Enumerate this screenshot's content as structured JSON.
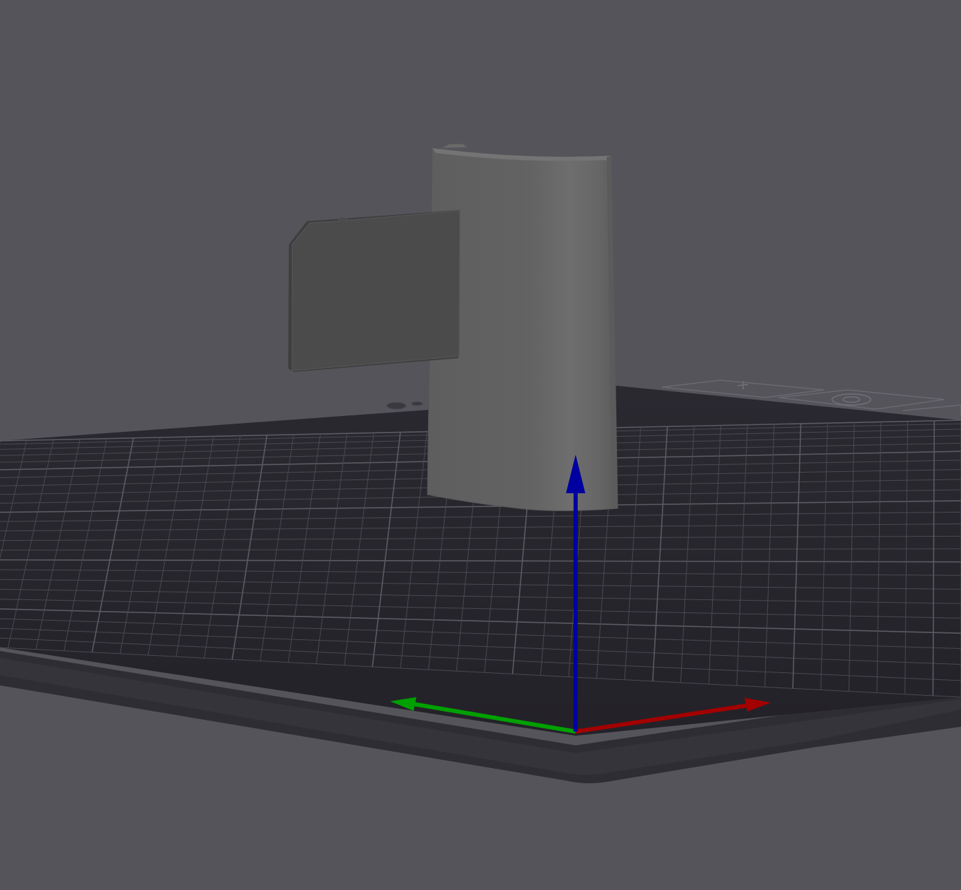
{
  "viewport": {
    "background_color": "#55545b",
    "bed_color": "#2c2b31",
    "bed_surface_color": "#25242a",
    "grid_color": "#4b4a52",
    "grid_major_color": "#5c5b63",
    "model_color": "#606060",
    "model_highlight_color": "#6d6d6d",
    "sd_card_color": "#4a4a4a"
  },
  "axes": {
    "x_axis": {
      "color": "#a30000",
      "name": "x-axis-arrow"
    },
    "y_axis": {
      "color": "#00a000",
      "name": "y-axis-arrow"
    },
    "z_axis": {
      "color": "#0000a0",
      "name": "z-axis-arrow"
    }
  },
  "objects": [
    {
      "kind": "curved-enclosure-model",
      "icon": "cylinder-shell"
    },
    {
      "kind": "sd-card-model",
      "icon": "sd-card"
    }
  ]
}
